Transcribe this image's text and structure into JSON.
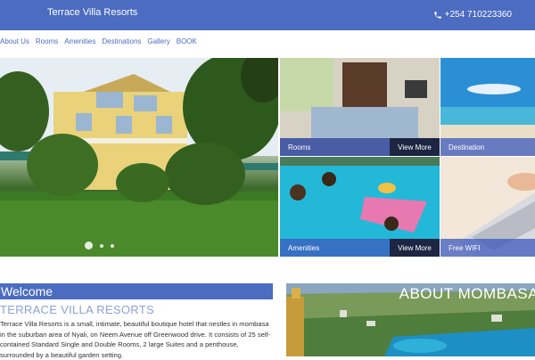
{
  "header": {
    "brand": "Terrace Villa Resorts",
    "phone": "+254 710223360",
    "phone_icon": "phone-icon"
  },
  "nav": {
    "items": [
      "About Us",
      "Rooms",
      "Amenities",
      "Destinations",
      "Gallery",
      "BOOK"
    ]
  },
  "hero": {
    "slide_count": 3,
    "active_slide": 1
  },
  "tiles": [
    {
      "caption": "Rooms",
      "action": "View More"
    },
    {
      "caption": "Destination"
    },
    {
      "caption": "Amenities",
      "action": "View More"
    },
    {
      "caption": "Free WIFI"
    }
  ],
  "welcome": {
    "heading": "Welcome",
    "subheading": "TERRACE VILLA RESORTS",
    "body": "Terrace Villa Resorts is a small, intimate, beautiful boutique hotel that nestles in mombasa in the suburban area of Nyali, on Neem Avenue off Greenwood drive. It consists of 25 self-contained Standard Single and Double Rooms, 2 large Suites and a penthouse, surrounded by a beautiful garden setting."
  },
  "about": {
    "heading": "ABOUT MOMBASA"
  },
  "colors": {
    "primary": "#4b6cc0",
    "caption_bg": "#3c5abe",
    "view_more_bg": "#1c2542",
    "subheading": "#8da1d7"
  }
}
